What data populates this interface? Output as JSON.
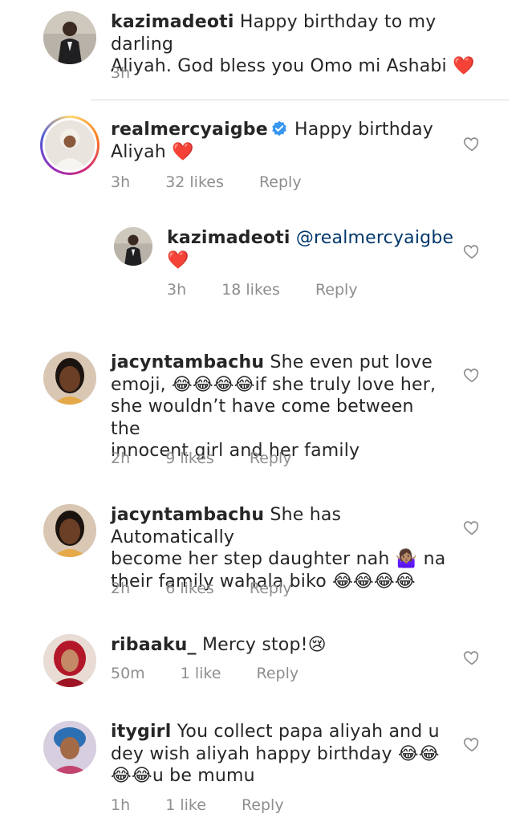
{
  "comments": [
    {
      "username": "kazimadeoti",
      "line1": "Happy birthday to my darling",
      "line2": "Aliyah. God bless you Omo mi Ashabi",
      "emoji": "❤️",
      "time": "3h",
      "likes": "",
      "reply": ""
    },
    {
      "username": "realmercyaigbe",
      "verified": true,
      "line1": "Happy birthday",
      "line2": "Aliyah",
      "emoji": "❤️",
      "time": "3h",
      "likes": "32 likes",
      "reply": "Reply"
    },
    {
      "username": "kazimadeoti",
      "mention": "@realmercyaigbe",
      "emoji": "❤️",
      "time": "3h",
      "likes": "18 likes",
      "reply": "Reply"
    },
    {
      "username": "jacyntambachu",
      "line1": "She even put love",
      "line2a": "emoji,",
      "emoji2": "😂😂😂😂",
      "line2b": "if she truly love her,",
      "line3": "she wouldn’t have come between the",
      "line4": "innocent girl and her family",
      "time": "2h",
      "likes": "9 likes",
      "reply": "Reply"
    },
    {
      "username": "jacyntambachu",
      "line1": "She has Automatically",
      "line2a": "become her step daughter nah",
      "emoji_shrug": "🤷🏽‍♀️",
      "line2b": "na",
      "line3": "their family wahala biko",
      "emoji3": "😂😂😂😂",
      "time": "2h",
      "likes": "6 likes",
      "reply": "Reply"
    },
    {
      "username": "ribaaku_",
      "line1": "Mercy stop!",
      "emoji": "😢",
      "time": "50m",
      "likes": "1 like",
      "reply": "Reply"
    },
    {
      "username": "itygirl",
      "line1": "You collect papa aliyah and u",
      "line2": "dey wish aliyah happy birthday",
      "emoji2": "😂😂",
      "emoji3": "😂😂",
      "line3": "u be mumu",
      "time": "1h",
      "likes": "1 like",
      "reply": "Reply"
    }
  ],
  "icons": {
    "like": "heart-outline-icon",
    "verified": "verified-badge-icon"
  },
  "colors": {
    "text": "#262626",
    "meta": "#8e8e8e",
    "verified": "#3897f0",
    "heart": "#ed4956",
    "mention": "#00376b"
  }
}
